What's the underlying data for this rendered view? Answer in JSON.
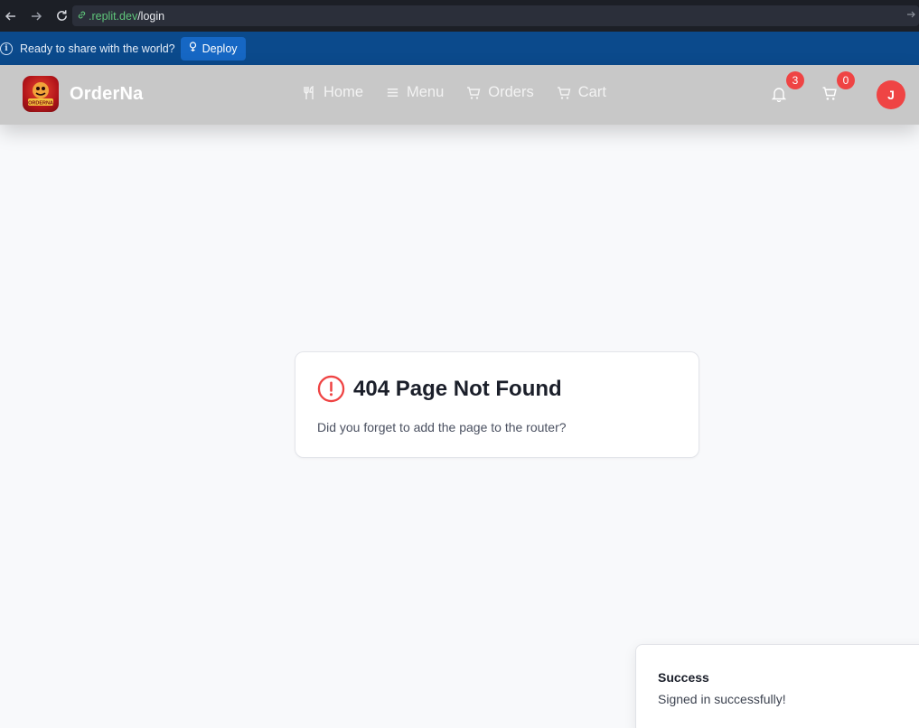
{
  "browser": {
    "url_domain": ".replit.dev",
    "url_path": "/login"
  },
  "banner": {
    "message": "Ready to share with the world?",
    "deploy_label": "Deploy"
  },
  "header": {
    "brand": "OrderNa",
    "logo_text": "ORDERNA",
    "nav": [
      {
        "label": "Home",
        "icon": "utensils-icon"
      },
      {
        "label": "Menu",
        "icon": "menu-icon"
      },
      {
        "label": "Orders",
        "icon": "cart-icon"
      },
      {
        "label": "Cart",
        "icon": "cart-icon"
      }
    ],
    "notifications_count": "3",
    "cart_count": "0",
    "avatar_initial": "J"
  },
  "not_found": {
    "title": "404 Page Not Found",
    "message": "Did you forget to add the page to the router?"
  },
  "toast": {
    "title": "Success",
    "description": "Signed in successfully!"
  },
  "colors": {
    "accent_red": "#ef4444",
    "header_bg": "#c8c8c8",
    "banner_bg": "#0b4a8c",
    "page_bg": "#f8f9fb"
  }
}
